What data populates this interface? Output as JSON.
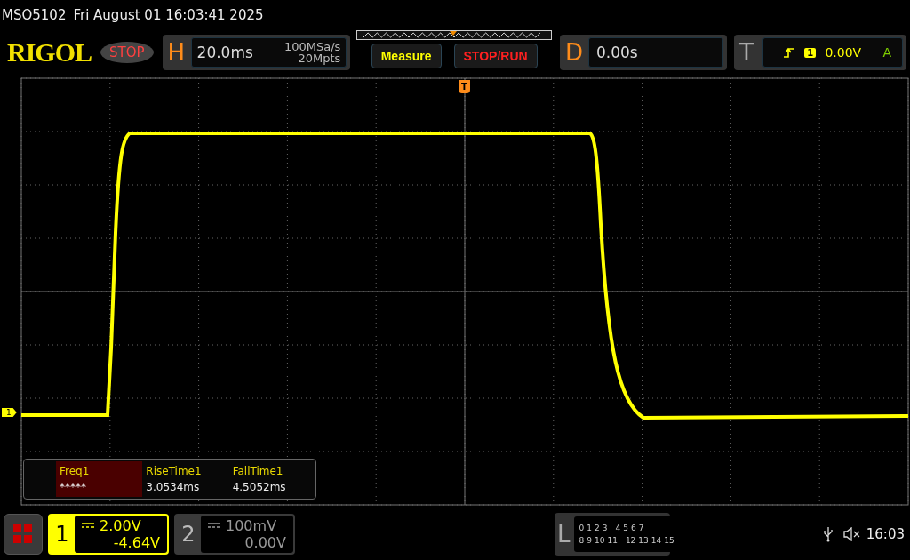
{
  "status_bar": {
    "model": "MSO5102",
    "datetime": "Fri August 01 16:03:41 2025"
  },
  "header": {
    "logo": "RIGOL",
    "run_state": "STOP",
    "horizontal": {
      "label": "H",
      "timebase": "20.0ms",
      "sample_rate": "100MSa/s",
      "memory_depth": "20Mpts"
    },
    "buttons": [
      "Measure",
      "STOP/RUN"
    ],
    "delay": {
      "label": "D",
      "value": "0.00s"
    },
    "trigger": {
      "label": "T",
      "source": "1",
      "level": "0.00V",
      "mode": "A"
    }
  },
  "screen": {
    "channel_marker": "1",
    "trigger_marker": "T"
  },
  "measurements": [
    {
      "name": "Freq1",
      "value": "*****",
      "selected": true
    },
    {
      "name": "RiseTime1",
      "value": "3.0534ms",
      "selected": false
    },
    {
      "name": "FallTime1",
      "value": "4.5052ms",
      "selected": false
    }
  ],
  "channels": [
    {
      "number": "1",
      "scale": "2.00V",
      "offset": "-4.64V",
      "on": true
    },
    {
      "number": "2",
      "scale": "100mV",
      "offset": "0.00V",
      "on": false
    }
  ],
  "logic": {
    "label": "L",
    "row_1": [
      "0",
      "1",
      "2",
      "3",
      "4",
      "5",
      "6",
      "7"
    ],
    "row_2": [
      "8",
      "9",
      "10",
      "11",
      "12",
      "13",
      "14",
      "15"
    ]
  },
  "system": {
    "clock": "16:03"
  }
}
